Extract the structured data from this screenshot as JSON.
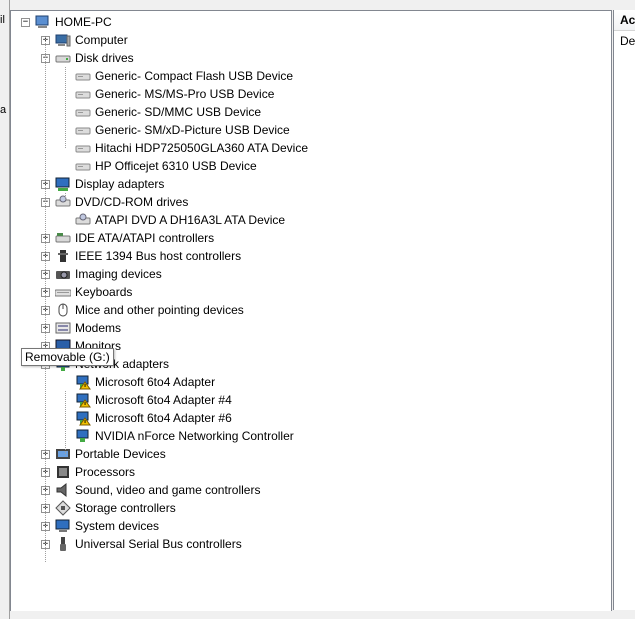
{
  "root": {
    "label": "HOME-PC"
  },
  "categories": [
    {
      "label": "Computer",
      "icon": "computer-icon",
      "expanded": false
    },
    {
      "label": "Disk drives",
      "icon": "disk-drive-icon",
      "expanded": true,
      "children": [
        "Generic- Compact Flash USB Device",
        "Generic- MS/MS-Pro USB Device",
        "Generic- SD/MMC USB Device",
        "Generic- SM/xD-Picture USB Device",
        "Hitachi HDP725050GLA360 ATA Device",
        "HP Officejet 6310 USB Device"
      ]
    },
    {
      "label": "Display adapters",
      "icon": "display-adapter-icon",
      "expanded": false
    },
    {
      "label": "DVD/CD-ROM drives",
      "icon": "dvd-drive-icon",
      "expanded": true,
      "children": [
        "ATAPI DVD A  DH16A3L ATA Device"
      ]
    },
    {
      "label": "IDE ATA/ATAPI controllers",
      "icon": "ide-controller-icon",
      "expanded": false
    },
    {
      "label": "IEEE 1394 Bus host controllers",
      "icon": "ieee1394-icon",
      "expanded": false
    },
    {
      "label": "Imaging devices",
      "icon": "imaging-device-icon",
      "expanded": false
    },
    {
      "label": "Keyboards",
      "icon": "keyboard-icon",
      "expanded": false
    },
    {
      "label": "Mice and other pointing devices",
      "icon": "mouse-icon",
      "expanded": false
    },
    {
      "label": "Modems",
      "icon": "modem-icon",
      "expanded": false
    },
    {
      "label": "Monitors",
      "icon": "monitor-icon",
      "expanded": false
    },
    {
      "label": "Network adapters",
      "icon": "network-adapter-icon",
      "expanded": true,
      "children": [
        {
          "label": "Microsoft 6to4 Adapter",
          "warning": true
        },
        {
          "label": "Microsoft 6to4 Adapter #4",
          "warning": true
        },
        {
          "label": "Microsoft 6to4 Adapter #6",
          "warning": true
        },
        {
          "label": "NVIDIA nForce Networking Controller",
          "warning": false
        }
      ]
    },
    {
      "label": "Portable Devices",
      "icon": "portable-device-icon",
      "expanded": false
    },
    {
      "label": "Processors",
      "icon": "processor-icon",
      "expanded": false
    },
    {
      "label": "Sound, video and game controllers",
      "icon": "sound-icon",
      "expanded": false
    },
    {
      "label": "Storage controllers",
      "icon": "storage-controller-icon",
      "expanded": false
    },
    {
      "label": "System devices",
      "icon": "system-device-icon",
      "expanded": false
    },
    {
      "label": "Universal Serial Bus controllers",
      "icon": "usb-icon",
      "expanded": false
    }
  ],
  "tooltip": {
    "text": "Removable (G:)"
  },
  "right_pane": {
    "header": "Ac",
    "row": "De"
  },
  "left_strip": {
    "frag1": "il",
    "frag2": "a"
  },
  "colors": {
    "warning": "#f2c200",
    "selection_border": "#828790"
  }
}
